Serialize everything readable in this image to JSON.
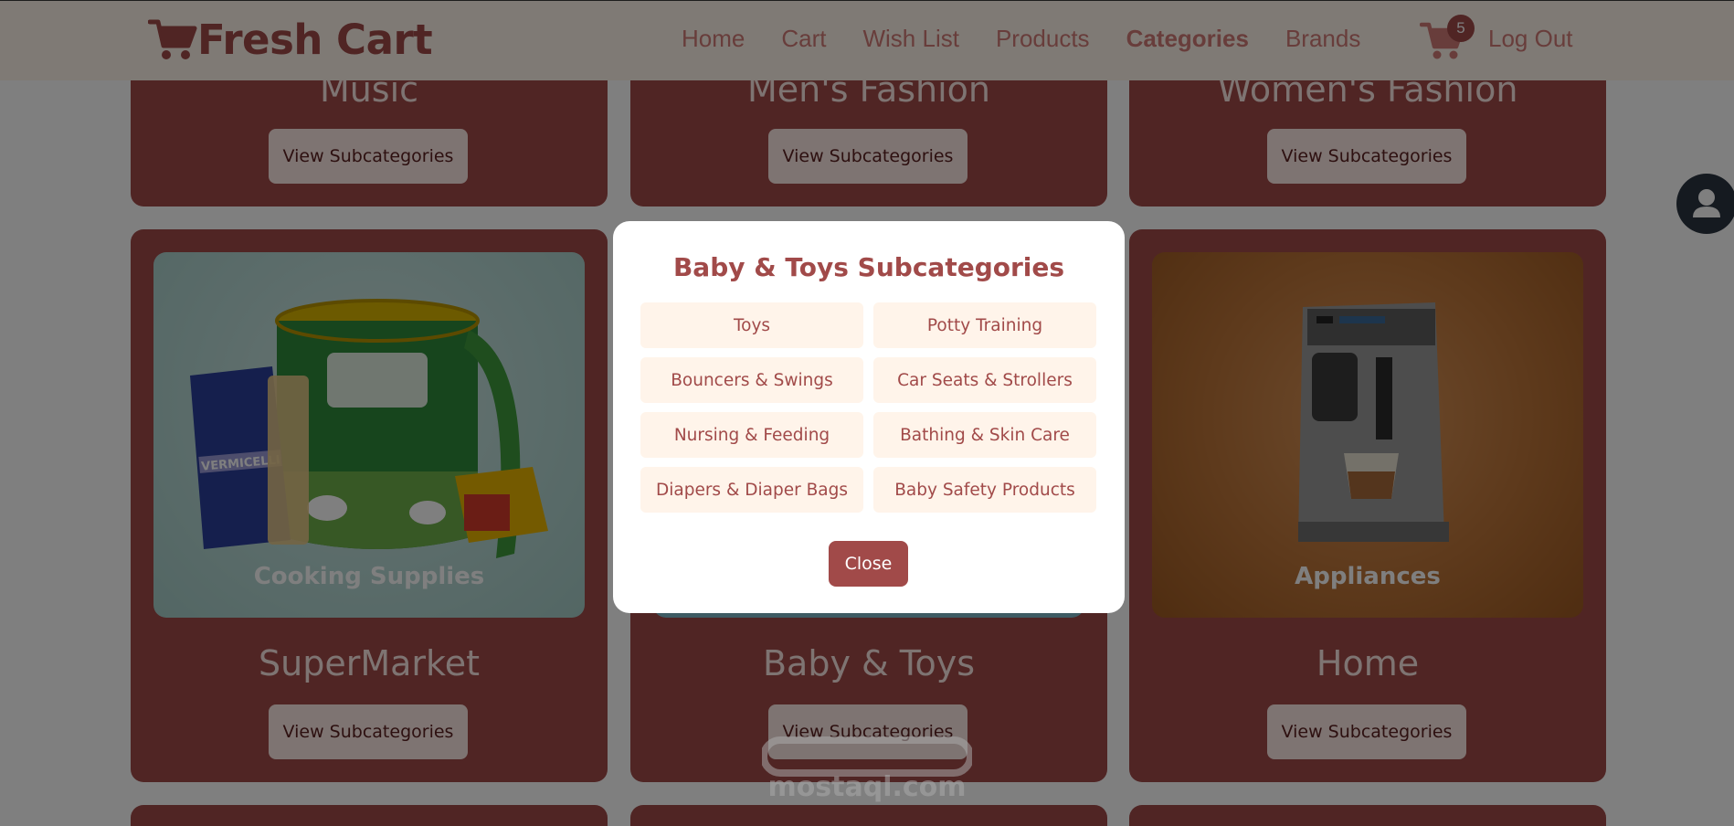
{
  "navbar": {
    "brand": "Fresh Cart",
    "links": [
      "Home",
      "Cart",
      "Wish List",
      "Products",
      "Categories",
      "Brands"
    ],
    "active_link": "Categories",
    "cart_count": "5",
    "logout": "Log Out",
    "colors": {
      "background": "#fff4ea",
      "brand": "#a14a49",
      "link": "#d17a76"
    }
  },
  "categories": {
    "top_row": [
      {
        "name": "Music",
        "button": "View Subcategories"
      },
      {
        "name": "Men's Fashion",
        "button": "View Subcategories"
      },
      {
        "name": "Women's Fashion",
        "button": "View Subcategories"
      }
    ],
    "middle_row": [
      {
        "name": "SuperMarket",
        "image_label": "Cooking Supplies",
        "button": "View Subcategories"
      },
      {
        "name": "Baby & Toys",
        "image_label": "",
        "button": "View Subcategories"
      },
      {
        "name": "Home",
        "image_label": "Appliances",
        "button": "View Subcategories"
      }
    ],
    "card_color": "#a14a49",
    "button_color": "#fde9e5"
  },
  "modal": {
    "title": "Baby & Toys Subcategories",
    "subcategories": [
      "Toys",
      "Potty Training",
      "Bouncers & Swings",
      "Car Seats & Strollers",
      "Nursing & Feeding",
      "Bathing & Skin Care",
      "Diapers & Diaper Bags",
      "Baby Safety Products"
    ],
    "close_label": "Close"
  },
  "product_art": {
    "supermarket_tin_label": "VERMICELLI"
  },
  "watermark": {
    "text": "mostaql.com"
  }
}
